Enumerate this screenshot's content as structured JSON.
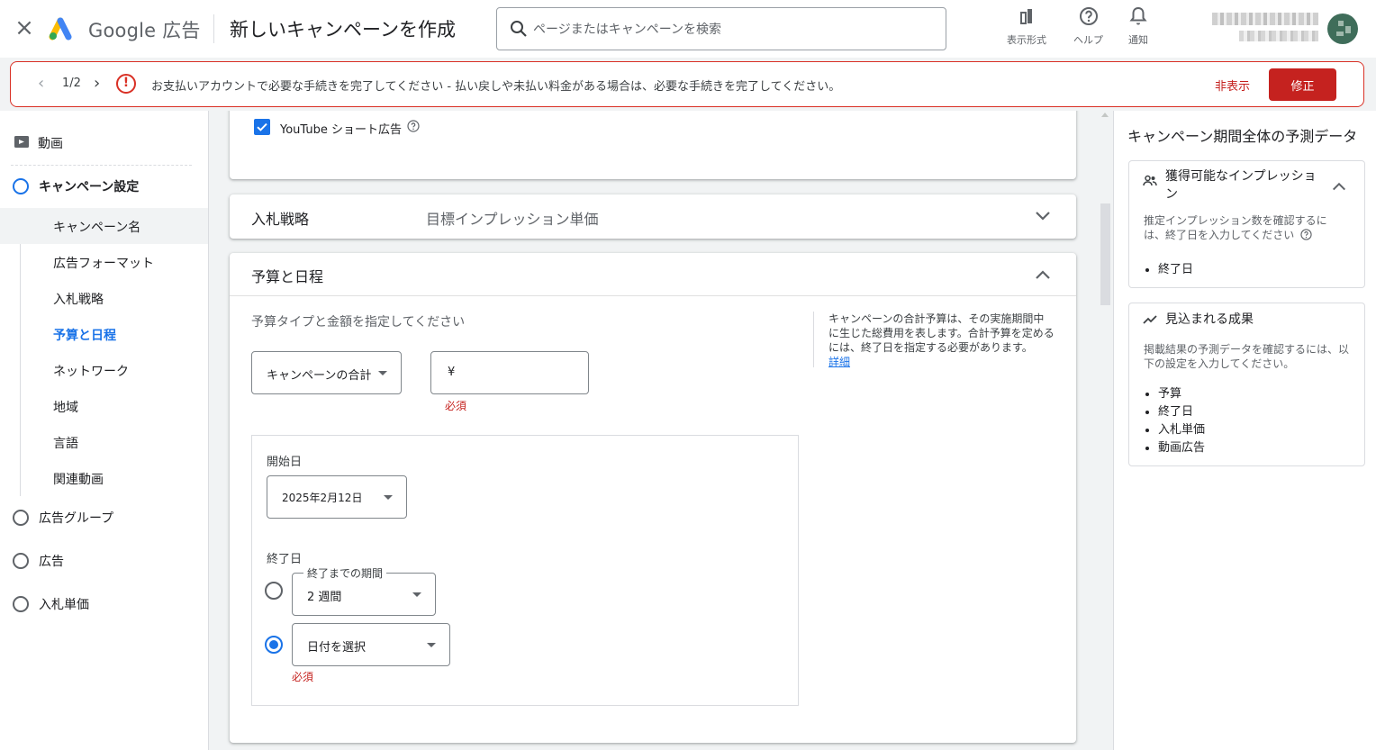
{
  "header": {
    "brand_google": "Google",
    "brand_ads": "広告",
    "page_title": "新しいキャンペーンを作成",
    "search_placeholder": "ページまたはキャンペーンを検索",
    "view_label": "表示形式",
    "help_label": "ヘルプ",
    "notify_label": "通知"
  },
  "alert": {
    "counter": "1/2",
    "message": "お支払いアカウントで必要な手続きを完了してください - 払い戻しや未払い料金がある場合は、必要な手続きを完了してください。",
    "hide_label": "非表示",
    "fix_label": "修正"
  },
  "sidebar": {
    "video_label": "動画",
    "campaign_settings_label": "キャンペーン設定",
    "sub_items": [
      "キャンペーン名",
      "広告フォーマット",
      "入札戦略",
      "予算と日程",
      "ネットワーク",
      "地域",
      "言語",
      "関連動画"
    ],
    "ad_group_label": "広告グループ",
    "ad_label": "広告",
    "bid_label": "入札単価"
  },
  "main": {
    "youtube_shorts_label": "YouTube ショート広告",
    "youtube_shorts_checked": true,
    "bidding": {
      "title": "入札戦略",
      "value": "目標インプレッション単価"
    },
    "budget": {
      "title": "予算と日程",
      "prompt": "予算タイプと金額を指定してください",
      "budget_type": "キャンペーンの合計",
      "currency": "¥",
      "required": "必須",
      "help_text": "キャンペーンの合計予算は、その実施期間中に生じた総費用を表します。合計予算を定めるには、終了日を指定する必要があります。",
      "help_link": "詳細",
      "start_label": "開始日",
      "start_value": "2025年2月12日",
      "end_label": "終了日",
      "duration_label": "終了までの期間",
      "duration_value": "2 週間",
      "date_select_value": "日付を選択",
      "date_required": "必須"
    }
  },
  "right_panel": {
    "title": "キャンペーン期間全体の予測データ",
    "impressions": {
      "title": "獲得可能なインプレッション",
      "desc": "推定インプレッション数を確認するには、終了日を入力してください",
      "items": [
        "終了日"
      ]
    },
    "results": {
      "title": "見込まれる成果",
      "desc": "掲載結果の予測データを確認するには、以下の設定を入力してください。",
      "items": [
        "予算",
        "終了日",
        "入札単価",
        "動画広告"
      ]
    }
  },
  "colors": {
    "accent": "#1a73e8",
    "error": "#d93025",
    "fix_button": "#c5221f"
  }
}
